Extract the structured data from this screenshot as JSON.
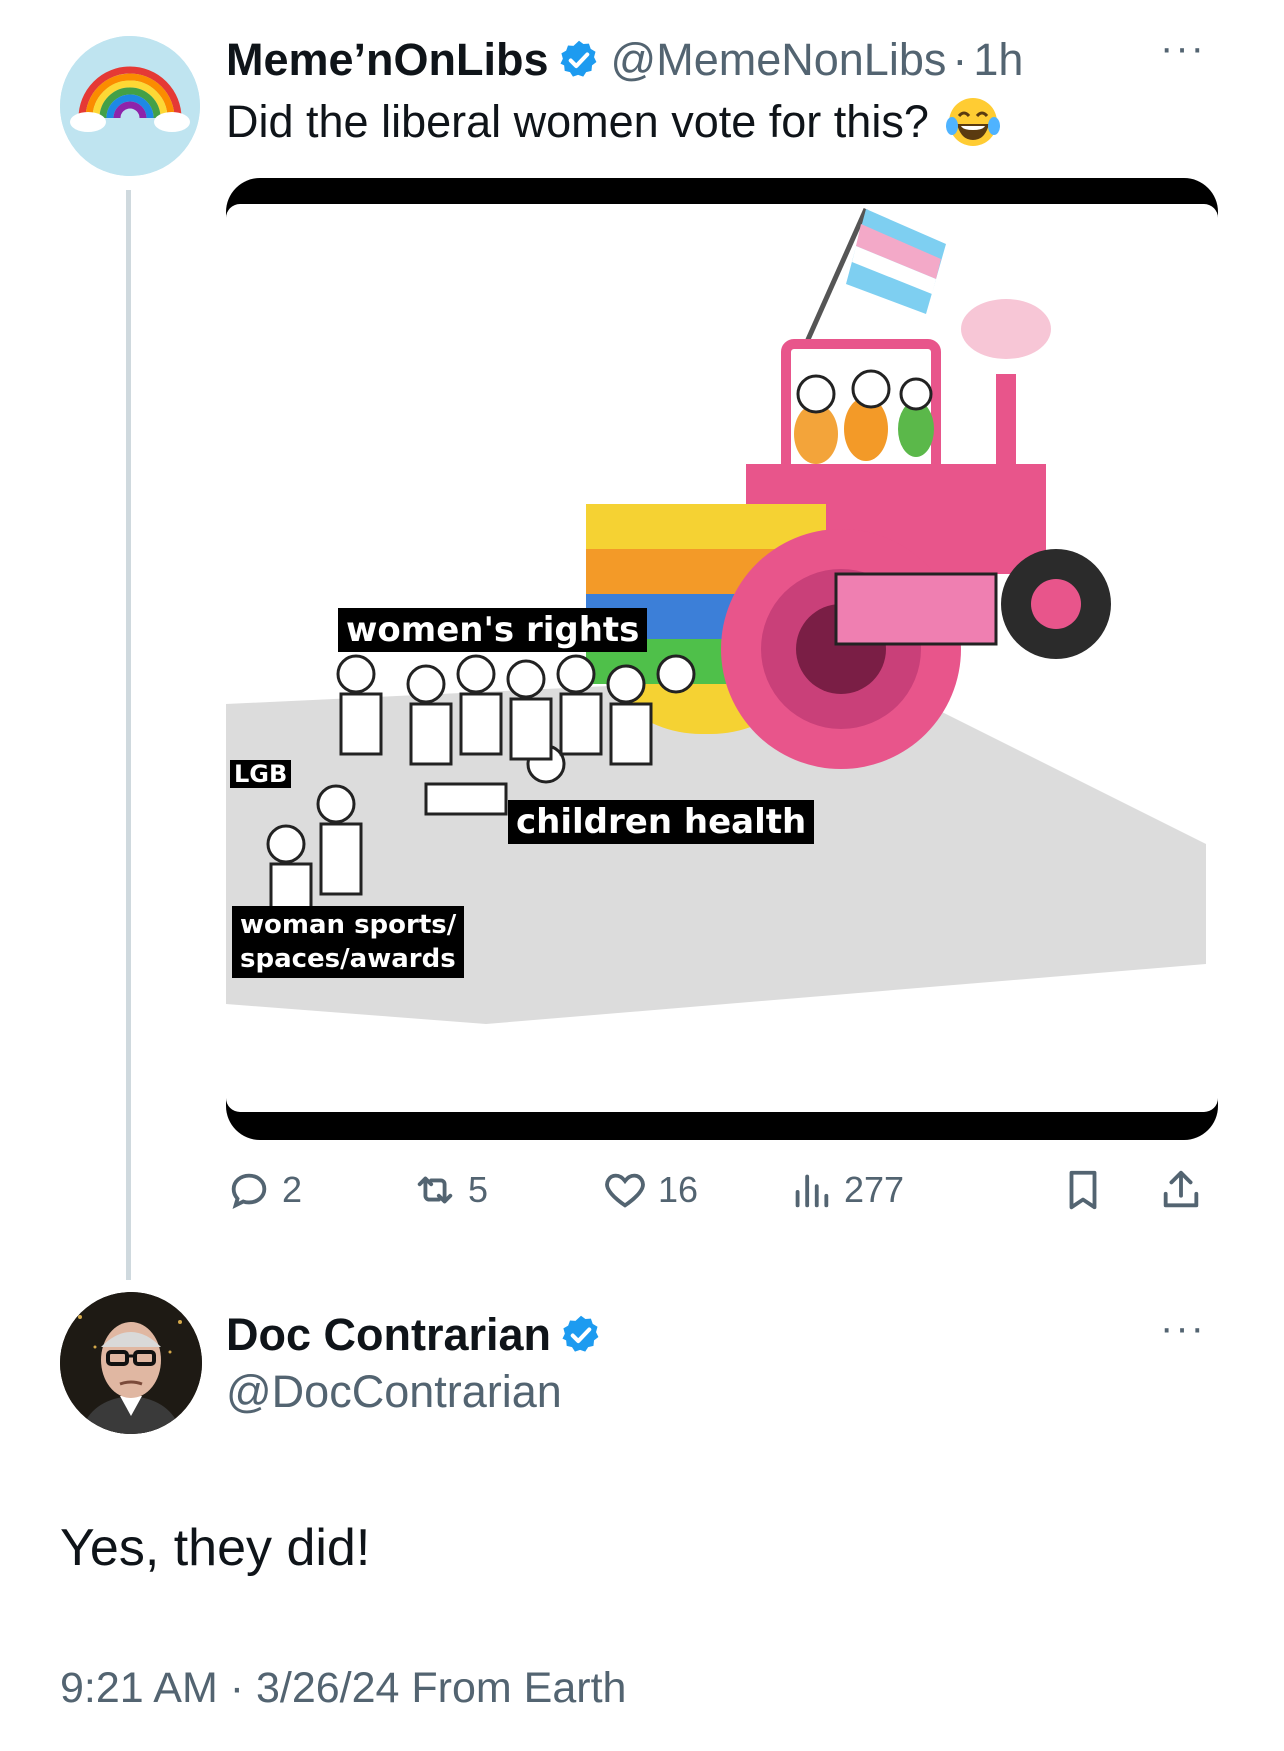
{
  "tweet": {
    "display_name": "Meme’nOnLibs",
    "handle": "@MemeNonLibs",
    "separator": "·",
    "time_ago": "1h",
    "text": "Did the liberal women vote for this?",
    "emoji": "face-with-tears-of-joy",
    "more": "···",
    "media": {
      "labels": {
        "womens_rights": "women's rights",
        "lgb": "LGB",
        "children_health": "children health",
        "woman_sports_line1": "woman sports/",
        "woman_sports_line2": "spaces/awards"
      }
    },
    "stats": {
      "replies": "2",
      "reposts": "5",
      "likes": "16",
      "views": "277"
    }
  },
  "reply": {
    "display_name": "Doc Contrarian",
    "handle": "@DocContrarian",
    "more": "···",
    "text": "Yes, they did!",
    "timestamp": "9:21 AM · 3/26/24 From Earth"
  },
  "colors": {
    "text_primary": "#0f1419",
    "text_secondary": "#536471",
    "verified_blue": "#1d9bf0",
    "thread_line": "#cfd9de"
  }
}
